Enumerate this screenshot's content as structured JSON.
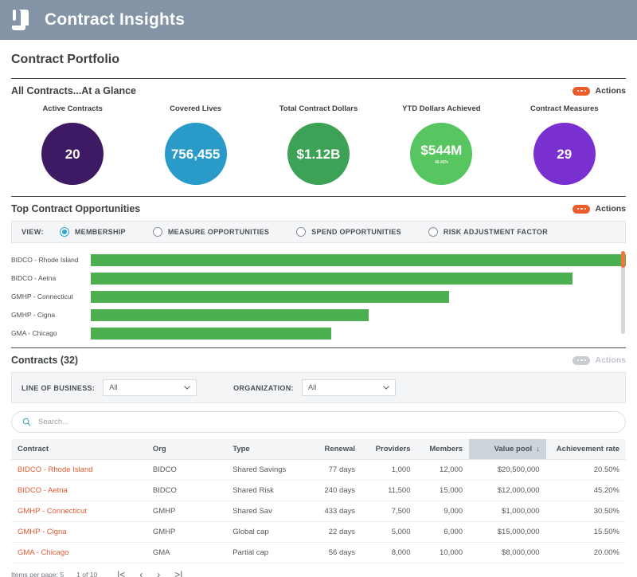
{
  "app": {
    "title": "Contract Insights",
    "logo_icon": "scroll-document-icon"
  },
  "page": {
    "title": "Contract Portfolio"
  },
  "glance": {
    "title": "All Contracts...At a Glance",
    "actions_label": "Actions",
    "kpis": [
      {
        "label": "Active Contracts",
        "value": "20",
        "sub": "",
        "color": "#3d1a63"
      },
      {
        "label": "Covered Lives",
        "value": "756,455",
        "sub": "",
        "color": "#2a9bc9"
      },
      {
        "label": "Total Contract Dollars",
        "value": "$1.12B",
        "sub": "",
        "color": "#3da256"
      },
      {
        "label": "YTD Dollars Achieved",
        "value": "$544M",
        "sub": "48.45%",
        "color": "#57c560"
      },
      {
        "label": "Contract Measures",
        "value": "29",
        "sub": "",
        "color": "#7a2fd0"
      }
    ]
  },
  "opportunities": {
    "title": "Top Contract Opportunities",
    "actions_label": "Actions",
    "view_label": "VIEW:",
    "view_options": [
      {
        "label": "MEMBERSHIP",
        "selected": true
      },
      {
        "label": "MEASURE OPPORTUNITIES",
        "selected": false
      },
      {
        "label": "SPEND OPPORTUNITIES",
        "selected": false
      },
      {
        "label": "RISK ADJUSTMENT FACTOR",
        "selected": false
      }
    ]
  },
  "chart_data": {
    "type": "bar",
    "title": "Top Contract Opportunities",
    "orientation": "horizontal",
    "categories": [
      "BIDCO - Rhode Island",
      "BIDCO - Aetna",
      "GMHP - Connecticut",
      "GMHP - Cigna",
      "GMA - Chicago"
    ],
    "values": [
      100,
      90,
      67,
      52,
      45
    ],
    "percent_of_track": [
      100,
      90,
      67,
      52,
      45
    ],
    "xlabel": "",
    "ylabel": "",
    "series_color": "#4caf50",
    "grid": false,
    "legend": "none"
  },
  "contracts": {
    "title": "Contracts",
    "count": "(32)",
    "actions_label": "Actions",
    "actions_disabled": true,
    "filters": [
      {
        "label": "LINE OF BUSINESS:",
        "value": "All"
      },
      {
        "label": "ORGANIZATION:",
        "value": "All"
      }
    ],
    "search": {
      "placeholder": "Search...",
      "value": "",
      "icon": "search-icon"
    },
    "columns": [
      {
        "label": "Contract",
        "align": "left",
        "sorted": false
      },
      {
        "label": "Org",
        "align": "left",
        "sorted": false
      },
      {
        "label": "Type",
        "align": "left",
        "sorted": false
      },
      {
        "label": "Renewal",
        "align": "right",
        "sorted": false
      },
      {
        "label": "Providers",
        "align": "right",
        "sorted": false
      },
      {
        "label": "Members",
        "align": "right",
        "sorted": false
      },
      {
        "label": "Value pool",
        "align": "right",
        "sorted": true,
        "sort_dir": "↓"
      },
      {
        "label": "Achievement rate",
        "align": "right",
        "sorted": false
      }
    ],
    "rows": [
      {
        "contract": "BIDCO - Rhode Island",
        "org": "BIDCO",
        "type": "Shared Savings",
        "renewal": "77 days",
        "providers": "1,000",
        "members": "12,000",
        "value_pool": "$20,500,000",
        "achievement_rate": "20.50%"
      },
      {
        "contract": "BIDCO - Aetna",
        "org": "BIDCO",
        "type": "Shared Risk",
        "renewal": "240 days",
        "providers": "11,500",
        "members": "15,000",
        "value_pool": "$12,000,000",
        "achievement_rate": "45.20%"
      },
      {
        "contract": "GMHP - Connecticut",
        "org": "GMHP",
        "type": "Shared Sav",
        "renewal": "433 days",
        "providers": "7,500",
        "members": "9,000",
        "value_pool": "$1,000,000",
        "achievement_rate": "30.50%"
      },
      {
        "contract": "GMHP - Cigna",
        "org": "GMHP",
        "type": "Global cap",
        "renewal": "22 days",
        "providers": "5,000",
        "members": "6,000",
        "value_pool": "$15,000,000",
        "achievement_rate": "15.50%"
      },
      {
        "contract": "GMA - Chicago",
        "org": "GMA",
        "type": "Partial cap",
        "renewal": "56 days",
        "providers": "8,000",
        "members": "10,000",
        "value_pool": "$8,000,000",
        "achievement_rate": "20.00%"
      }
    ],
    "paginator": {
      "items_per_page_label": "Items per page:",
      "items_per_page_value": "5",
      "range_label": "1 of 10",
      "first_label": "|<",
      "prev_label": "‹",
      "next_label": "›",
      "last_label": ">|"
    }
  }
}
